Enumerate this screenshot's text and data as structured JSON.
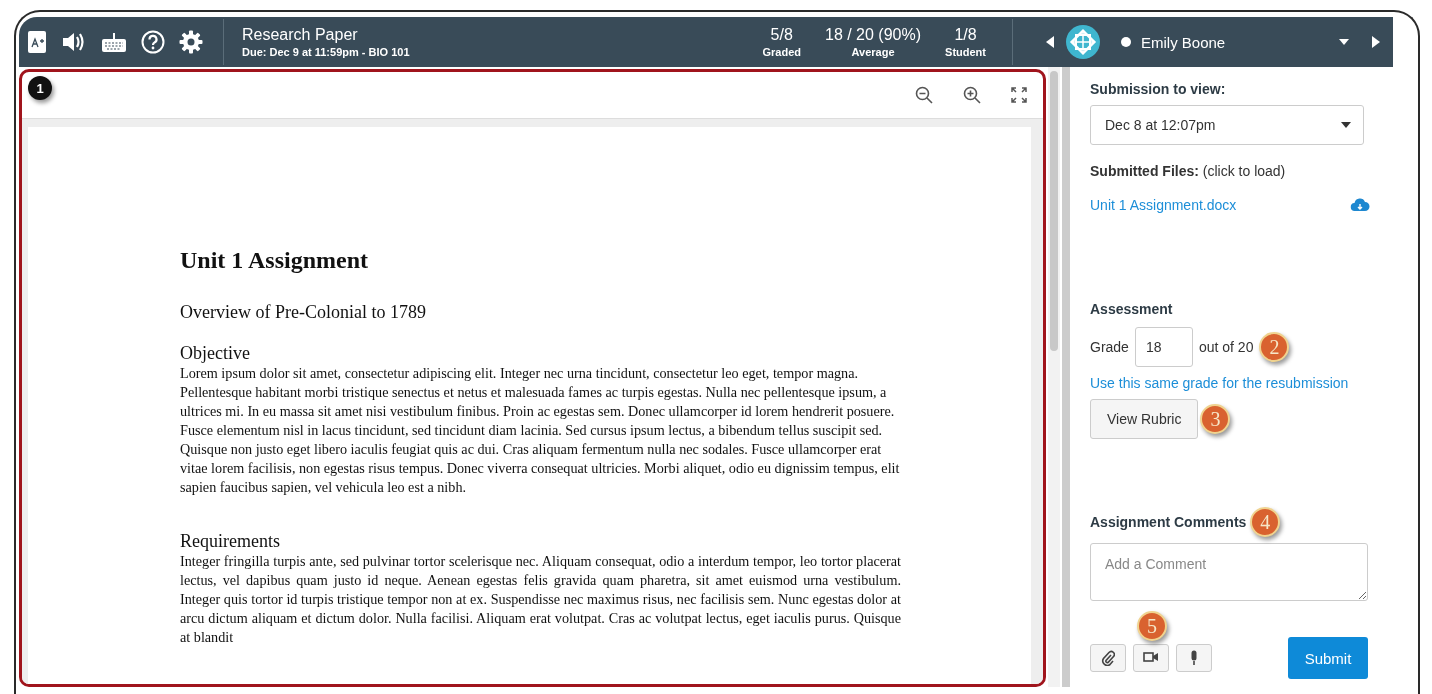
{
  "assignment": {
    "title": "Research Paper",
    "due": "Due: Dec 9 at 11:59pm - BIO 101"
  },
  "stats": [
    {
      "value": "5/8",
      "label": "Graded"
    },
    {
      "value": "18 / 20 (90%)",
      "label": "Average"
    },
    {
      "value": "1/8",
      "label": "Student"
    }
  ],
  "student": {
    "name": "Emily Boone"
  },
  "document": {
    "title": "Unit 1 Assignment",
    "subtitle": "Overview of Pre-Colonial to 1789",
    "sections": [
      {
        "heading": "Objective",
        "body": "Lorem ipsum dolor sit amet, consectetur adipiscing elit. Integer nec urna tincidunt, consectetur leo eget, tempor magna. Pellentesque habitant morbi tristique senectus et netus et malesuada fames ac turpis egestas. Nulla nec pellentesque ipsum, a ultrices mi. In eu massa sit amet nisi vestibulum finibus. Proin ac egestas sem. Donec ullamcorper id lorem hendrerit posuere. Fusce elementum nisl in lacus tincidunt, sed tincidunt diam lacinia. Sed cursus ipsum lectus, a bibendum tellus suscipit sed. Quisque non justo eget libero iaculis feugiat quis ac dui. Cras aliquam fermentum nulla nec sodales. Fusce ullamcorper erat vitae lorem facilisis, non egestas risus tempus. Donec viverra consequat ultricies. Morbi aliquet, odio eu dignissim tempus, elit sapien faucibus sapien, vel vehicula leo est a nibh."
      },
      {
        "heading": "Requirements",
        "body": "Integer fringilla turpis ante, sed pulvinar tortor scelerisque nec. Aliquam consequat, odio a interdum tempor, leo tortor placerat lectus, vel dapibus quam justo id neque. Aenean egestas felis gravida quam pharetra, sit amet euismod urna vestibulum. Integer quis tortor id turpis tristique tempor non at ex. Suspendisse nec maximus risus, nec facilisis sem. Nunc egestas dolor at arcu dictum aliquam et dictum dolor. Nulla facilisi. Aliquam erat volutpat. Cras ac volutpat lectus, eget iaculis purus. Quisque at blandit"
      }
    ]
  },
  "sidebar": {
    "submission_label": "Submission to view:",
    "submission_value": "Dec 8 at 12:07pm",
    "files_label": "**Submitted Files:** (click to load)",
    "file": "Unit 1 Assignment.docx",
    "assessment_label": "Assessment",
    "grade_label": "Grade",
    "grade_value": "18",
    "out_of": "out of 20",
    "resubmission_link": "Use this same grade for the resubmission",
    "rubric_button": "View Rubric",
    "comments_label": "Assignment Comments",
    "comment_placeholder": "Add a Comment",
    "submit_button": "Submit"
  },
  "callouts": [
    {
      "number": "1"
    },
    {
      "number": "2"
    },
    {
      "number": "3"
    },
    {
      "number": "4"
    },
    {
      "number": "5"
    }
  ]
}
